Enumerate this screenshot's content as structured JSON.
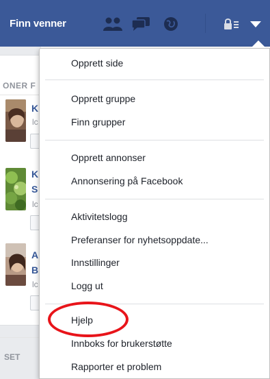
{
  "topbar": {
    "title": "Finn venner",
    "color": "#3b5998"
  },
  "background_page": {
    "section_header": "ONER F",
    "footer_text": "SET",
    "people": [
      {
        "initial": "K",
        "sub_initial": "",
        "sub": "lc"
      },
      {
        "initial": "K",
        "sub_initial": "S",
        "sub": "lc"
      },
      {
        "initial": "A",
        "sub_initial": "B",
        "sub": "lc"
      }
    ]
  },
  "menu": {
    "groups": [
      [
        {
          "label": "Opprett side"
        }
      ],
      [
        {
          "label": "Opprett gruppe"
        },
        {
          "label": "Finn grupper"
        }
      ],
      [
        {
          "label": "Opprett annonser"
        },
        {
          "label": "Annonsering på Facebook"
        }
      ],
      [
        {
          "label": "Aktivitetslogg"
        },
        {
          "label": "Preferanser for nyhetsoppdate..."
        },
        {
          "label": "Innstillinger"
        },
        {
          "label": "Logg ut"
        }
      ],
      [
        {
          "label": "Hjelp"
        },
        {
          "label": "Innboks for brukerstøtte"
        },
        {
          "label": "Rapporter et problem"
        }
      ]
    ]
  },
  "annotation": {
    "highlighted_item": "Hjelp",
    "color": "#e8141a"
  },
  "icons": [
    "friends-icon",
    "messages-icon",
    "globe-icon",
    "privacy-lock-icon",
    "account-menu-icon"
  ]
}
